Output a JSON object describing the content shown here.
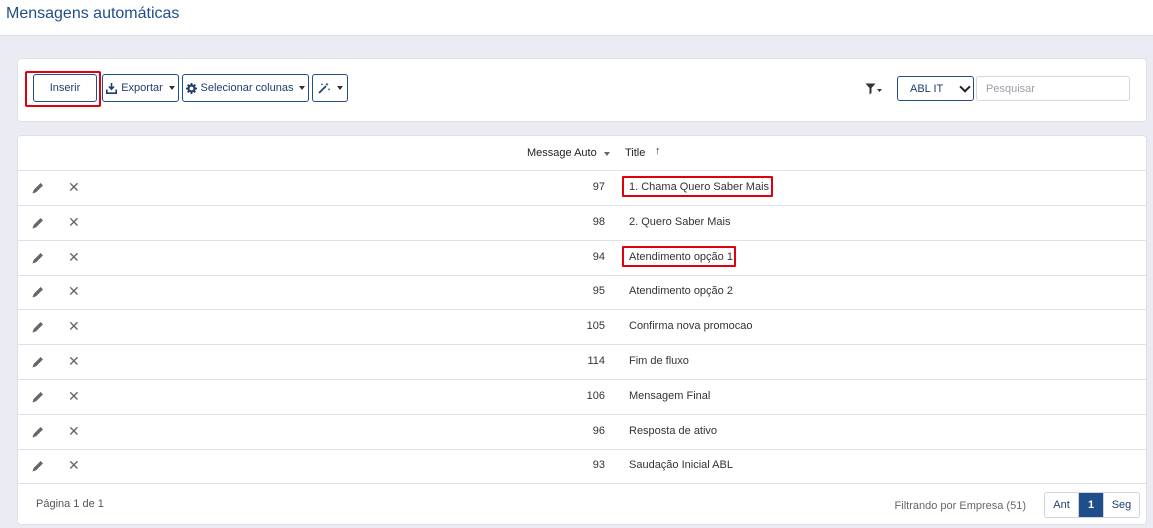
{
  "header": {
    "title": "Mensagens automáticas"
  },
  "toolbar": {
    "insert_label": "Inserir",
    "export_label": "Exportar",
    "columns_label": "Selecionar colunas",
    "company_select": "ABL IT",
    "search_placeholder": "Pesquisar"
  },
  "table": {
    "col_message": "Message Auto",
    "col_title": "Title",
    "title_sort_arrow": "↑",
    "delete_glyph": "✕",
    "rows": [
      {
        "id": "97",
        "title": "1. Chama Quero Saber Mais",
        "highlighted": true
      },
      {
        "id": "98",
        "title": "2. Quero Saber Mais",
        "highlighted": false
      },
      {
        "id": "94",
        "title": "Atendimento opção 1",
        "highlighted": true
      },
      {
        "id": "95",
        "title": "Atendimento opção 2",
        "highlighted": false
      },
      {
        "id": "105",
        "title": "Confirma nova promocao",
        "highlighted": false
      },
      {
        "id": "114",
        "title": "Fim de fluxo",
        "highlighted": false
      },
      {
        "id": "106",
        "title": "Mensagem Final",
        "highlighted": false
      },
      {
        "id": "96",
        "title": "Resposta de ativo",
        "highlighted": false
      },
      {
        "id": "93",
        "title": "Saudação Inicial ABL",
        "highlighted": false
      }
    ]
  },
  "footer": {
    "page_info": "Página 1 de 1",
    "filter_info": "Filtrando por Empresa (51)",
    "prev_label": "Ant",
    "current_page": "1",
    "next_label": "Seg"
  },
  "colors": {
    "accent": "#1f4e8a",
    "highlight": "#e0000f",
    "background": "#ebecf3"
  }
}
